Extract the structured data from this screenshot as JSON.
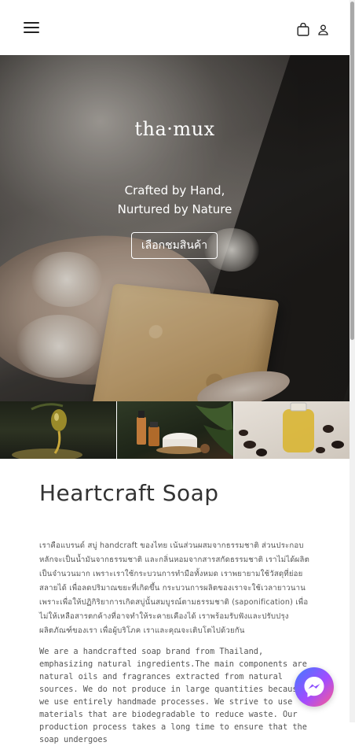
{
  "header": {
    "menu_icon": "hamburger-menu-icon",
    "cart_icon": "shopping-bag-icon",
    "account_icon": "user-account-icon"
  },
  "hero": {
    "brand": "tha·mux",
    "tagline_line1": "Crafted by Hand,",
    "tagline_line2": "Nurtured by Nature",
    "cta_label": "เลือกชมสินค้า"
  },
  "gallery": {
    "images": [
      "olive-oil-image",
      "cosmetic-products-image",
      "oil-and-seeds-image"
    ]
  },
  "about": {
    "title": "Heartcraft Soap",
    "paragraph_th": "เราคือแบรนด์ สบู่ handcraft ของไทย เน้นส่วนผสมจากธรรมชาติ ส่วนประกอบหลักจะเป็นน้ำมันจากธรรมชาติ และกลิ่นหอมจากสารสกัดธรรมชาติ เราไม่ได้ผลิตเป็นจำนวนมาก เพราะเราใช้กระบวนการทำมือทั้งหมด เราพยายามใช้วัสดุที่ย่อยสลายได้ เพื่อลดปริมาณขยะที่เกิดขึ้น กระบวนการผลิตของเราจะใช้เวลายาวนาน เพราะเพื่อให้ปฏิกิริยาการเกิดสบู่นั้นสมบูรณ์ตามธรรมชาติ (saponification) เพื่อไม่ให้เหลือสารตกค้างที่อาจทำให้ระคายเคืองได้ เราพร้อมรับฟังและปรับปรุงผลิตภัณฑ์ของเรา เพื่อผู้บริโภค เราและคุณจะเติบโตไปด้วยกัน",
    "paragraph_en": "We are a handcrafted soap brand from Thailand, emphasizing natural ingredients.The main components are natural oils and fragrances extracted from natural sources. We do not produce in large quantities because we use entirely handmade processes. We strive to use materials that are biodegradable to reduce waste. Our production process takes a long time to ensure that the soap undergoes"
  },
  "floating": {
    "messenger_icon": "messenger-icon"
  },
  "colors": {
    "background": "#ffffff",
    "text": "#333333",
    "hero_text": "#ffffff"
  }
}
